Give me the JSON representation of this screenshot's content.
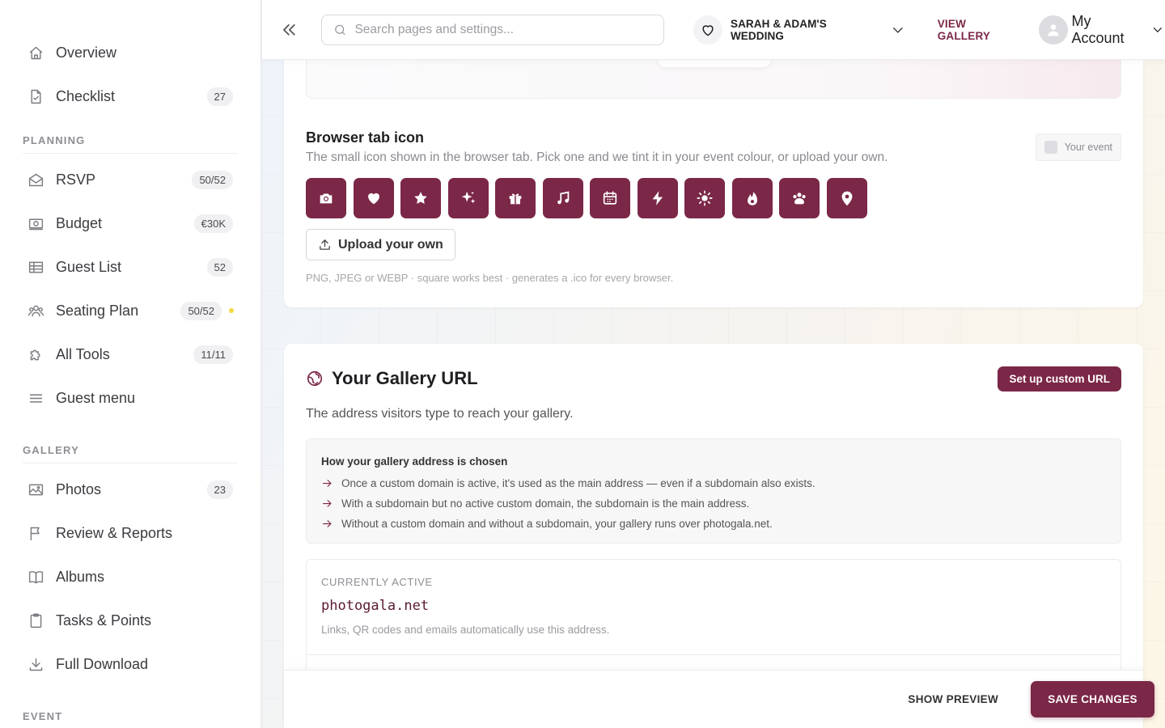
{
  "sidebar": {
    "top_items": [
      {
        "label": "Overview",
        "badge": null,
        "icon": "home-icon"
      },
      {
        "label": "Checklist",
        "badge": "27",
        "icon": "checklist-icon"
      }
    ],
    "sections": [
      {
        "title": "PLANNING",
        "items": [
          {
            "label": "RSVP",
            "badge": "50/52",
            "icon": "envelope-icon"
          },
          {
            "label": "Budget",
            "badge": "€30K",
            "icon": "money-icon"
          },
          {
            "label": "Guest List",
            "badge": "52",
            "icon": "table-icon"
          },
          {
            "label": "Seating Plan",
            "badge": "50/52",
            "icon": "people-icon",
            "dot": true
          },
          {
            "label": "All Tools",
            "badge": "11/11",
            "icon": "puzzle-icon"
          },
          {
            "label": "Guest menu",
            "badge": null,
            "icon": "menu-icon"
          }
        ]
      },
      {
        "title": "GALLERY",
        "items": [
          {
            "label": "Photos",
            "badge": "23",
            "icon": "image-icon"
          },
          {
            "label": "Review & Reports",
            "badge": null,
            "icon": "flag-icon"
          },
          {
            "label": "Albums",
            "badge": null,
            "icon": "book-icon"
          },
          {
            "label": "Tasks & Points",
            "badge": null,
            "icon": "clipboard-icon"
          },
          {
            "label": "Full Download",
            "badge": null,
            "icon": "download-icon"
          }
        ]
      },
      {
        "title": "EVENT",
        "items": []
      }
    ]
  },
  "topbar": {
    "search_placeholder": "Search pages and settings...",
    "event_name": "SARAH & ADAM'S WEDDING",
    "view_gallery": "VIEW GALLERY",
    "account_label": "My Account"
  },
  "browser_tab": {
    "title": "Browser tab icon",
    "description": "The small icon shown in the browser tab. Pick one and we tint it in your event colour, or upload your own.",
    "your_event": "Your event",
    "icons": [
      "camera-icon",
      "heart-icon",
      "star-icon",
      "sparkles-icon",
      "gift-icon",
      "music-icon",
      "calendar-icon",
      "bolt-icon",
      "sun-icon",
      "flame-icon",
      "paw-icon",
      "location-icon"
    ],
    "upload_label": "Upload your own",
    "upload_hint": "PNG, JPEG or WEBP · square works best · generates a .ico for every browser."
  },
  "gallery_url": {
    "title": "Your Gallery URL",
    "button": "Set up custom URL",
    "description": "The address visitors type to reach your gallery.",
    "info_title": "How your gallery address is chosen",
    "info_rows": [
      "Once a custom domain is active, it's used as the main address — even if a subdomain also exists.",
      "With a subdomain but no active custom domain, the subdomain is the main address.",
      "Without a custom domain and without a subdomain, your gallery runs over photogala.net."
    ],
    "active_label": "CURRENTLY ACTIVE",
    "active_domain": "photogala.net",
    "active_hint": "Links, QR codes and emails automatically use this address."
  },
  "actions": {
    "show_preview": "SHOW PREVIEW",
    "save": "SAVE CHANGES"
  },
  "colors": {
    "accent": "#7b2748",
    "dot": "#f5d842"
  }
}
